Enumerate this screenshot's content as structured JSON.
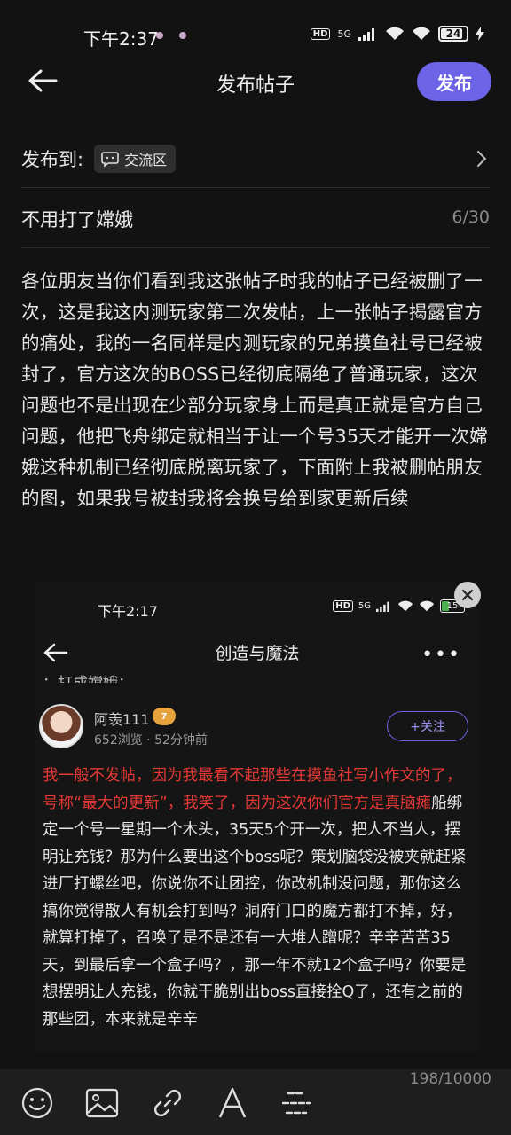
{
  "status": {
    "time": "下午2:37",
    "network": "5G",
    "battery": "24"
  },
  "header": {
    "title": "发布帖子",
    "publish_label": "发布"
  },
  "post_to": {
    "label": "发布到:",
    "channel": "交流区"
  },
  "post_title": {
    "value": "不用打了嫦娥",
    "count": "6/30"
  },
  "post_body": "各位朋友当你们看到我这张帖子时我的帖子已经被删了一次，这是我这内测玩家第二次发帖，上一张帖子揭露官方的痛处，我的一名同样是内测玩家的兄弟摸鱼社号已经被封了，官方这次的BOSS已经彻底隔绝了普通玩家，这次问题也不是出现在少部分玩家身上而是真正就是官方自己问题，他把飞舟绑定就相当于让一个号35天才能开一次嫦娥这种机制已经彻底脱离玩家了，下面附上我被删帖朋友的图，如果我号被封我将会换号给到家更新后续",
  "embedded_image": {
    "status_time": "下午2:17",
    "battery": "15",
    "header_title": "创造与魔法",
    "cut_text": "：打成嫦娥：",
    "username": "阿羡111",
    "level": "7",
    "meta": "652浏览 · 52分钟前",
    "follow_label": "+关注",
    "content_red": "我一般不发帖，因为我最看不起那些在摸鱼社写小作文的了，号称“最大的更新”，我笑了，因为这次你们官方是真脑瘫",
    "content_rest": "船绑定一个号一星期一个木头，35天5个开一次，把人不当人，摆明让充钱？那为什么要出这个boss呢？策划脑袋没被夹就赶紧进厂打螺丝吧，你说你不让团控，你改机制没问题，那你这么搞你觉得散人有机会打到吗？洞府门口的魔方都打不掉，好，就算打掉了，召唤了是不是还有一大堆人蹭呢？辛辛苦苦35天，到最后拿一个盒子吗？，那一年不就12个盒子吗？你要是想摆明让人充钱，你就干脆别出boss直接拴Q了，还有之前的那些团，本来就是辛辛"
  },
  "editor": {
    "char_count": "198/10000"
  },
  "colors": {
    "accent": "#6c63e6",
    "background": "#121212",
    "highlight_red": "#e53935"
  }
}
